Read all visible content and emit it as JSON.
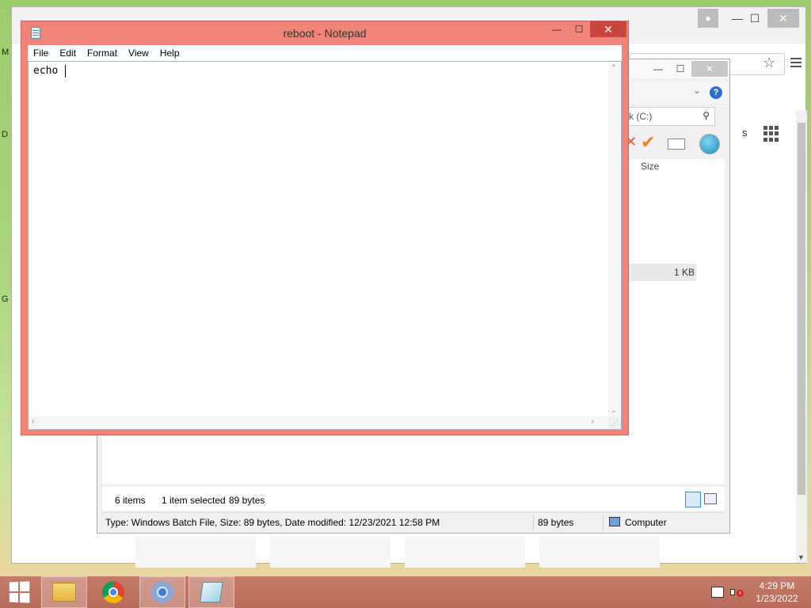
{
  "desktop": {
    "edge_letters": [
      "M",
      "D",
      "G"
    ]
  },
  "browser": {
    "minimize": "—",
    "maximize": "☐",
    "close": "✕",
    "star_icon": "star-outline-icon",
    "menu_icon": "hamburger-menu-icon",
    "apps_icon": "apps-grid-icon",
    "partial_text": "s"
  },
  "explorer": {
    "minimize": "—",
    "maximize": "☐",
    "close": "✕",
    "chevron": "⌄",
    "help": "?",
    "search_text": "k (C:)",
    "search_icon": "🔍",
    "size_header": "Size",
    "file_size_kb": "1 KB",
    "status_items": "6 items",
    "status_selected": "1 item selected",
    "status_bytes": "89 bytes",
    "details": "Type: Windows Batch File, Size: 89 bytes, Date modified: 12/23/2021 12:58 PM",
    "details_size": "89 bytes",
    "location": "Computer"
  },
  "notepad": {
    "title": "reboot - Notepad",
    "minimize": "—",
    "maximize": "☐",
    "close": "✕",
    "menu": [
      "File",
      "Edit",
      "Format",
      "View",
      "Help"
    ],
    "content": "echo "
  },
  "taskbar": {
    "apps": [
      {
        "name": "file-explorer"
      },
      {
        "name": "google-chrome"
      },
      {
        "name": "chromium"
      },
      {
        "name": "notepad"
      }
    ],
    "time": "4:29 PM",
    "date": "1/23/2022"
  },
  "colors": {
    "notepad_frame": "#f08479",
    "notepad_close": "#c8443c",
    "taskbar": "#c57c6a"
  }
}
